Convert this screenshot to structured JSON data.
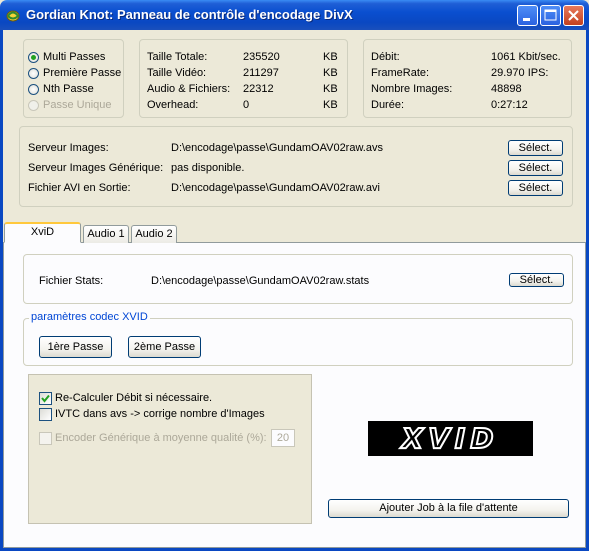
{
  "window": {
    "title": "Gordian Knot:  Panneau de contrôle d'encodage DivX",
    "app_icon": "gordian-knot-icon",
    "controls": [
      "minimize-icon",
      "maximize-icon",
      "close-icon"
    ]
  },
  "passes": {
    "options": [
      {
        "label": "Multi Passes",
        "selected": true,
        "enabled": true
      },
      {
        "label": "Première Passe",
        "selected": false,
        "enabled": true
      },
      {
        "label": "Nth Passe",
        "selected": false,
        "enabled": true
      },
      {
        "label": "Passe Unique",
        "selected": false,
        "enabled": false
      }
    ]
  },
  "sizes": {
    "rows": [
      {
        "label": "Taille Totale:",
        "value": "235520",
        "unit": "KB"
      },
      {
        "label": "Taille Vidéo:",
        "value": "211297",
        "unit": "KB"
      },
      {
        "label": "Audio & Fichiers:",
        "value": "22312",
        "unit": "KB"
      },
      {
        "label": "Overhead:",
        "value": "0",
        "unit": "KB"
      }
    ]
  },
  "stats": {
    "rows": [
      {
        "label": "Débit:",
        "value": "1061 Kbit/sec."
      },
      {
        "label": "FrameRate:",
        "value": "29.970 IPS:"
      },
      {
        "label": "Nombre Images:",
        "value": "48898"
      },
      {
        "label": "Durée:",
        "value": "0:27:12"
      }
    ]
  },
  "files": {
    "rows": [
      {
        "label": "Serveur Images:",
        "value": "D:\\encodage\\passe\\GundamOAV02raw.avs",
        "button": "Sélect."
      },
      {
        "label": "Serveur Images Générique:",
        "value": "pas disponible.",
        "button": "Sélect."
      },
      {
        "label": "Fichier AVI en Sortie:",
        "value": "D:\\encodage\\passe\\GundamOAV02raw.avi",
        "button": "Sélect."
      }
    ]
  },
  "tabs": [
    "XviD",
    "Audio 1",
    "Audio 2"
  ],
  "xvid": {
    "stats_label": "Fichier Stats:",
    "stats_value": "D:\\encodage\\passe\\GundamOAV02raw.stats",
    "stats_button": "Sélect.",
    "codec_group": "paramètres codec XVID",
    "pass1_button": "1ère Passe",
    "pass2_button": "2ème Passe",
    "options": [
      {
        "label": "Re-Calculer Débit si nécessaire.",
        "checked": true,
        "enabled": true
      },
      {
        "label": "IVTC dans avs -> corrige nombre d'Images",
        "checked": false,
        "enabled": true
      },
      {
        "label": "Encoder Générique à moyenne qualité (%):",
        "checked": false,
        "enabled": false
      }
    ],
    "quality_value": "20",
    "logo_text": "XVID",
    "add_job_button": "Ajouter Job à la file d'attente"
  }
}
